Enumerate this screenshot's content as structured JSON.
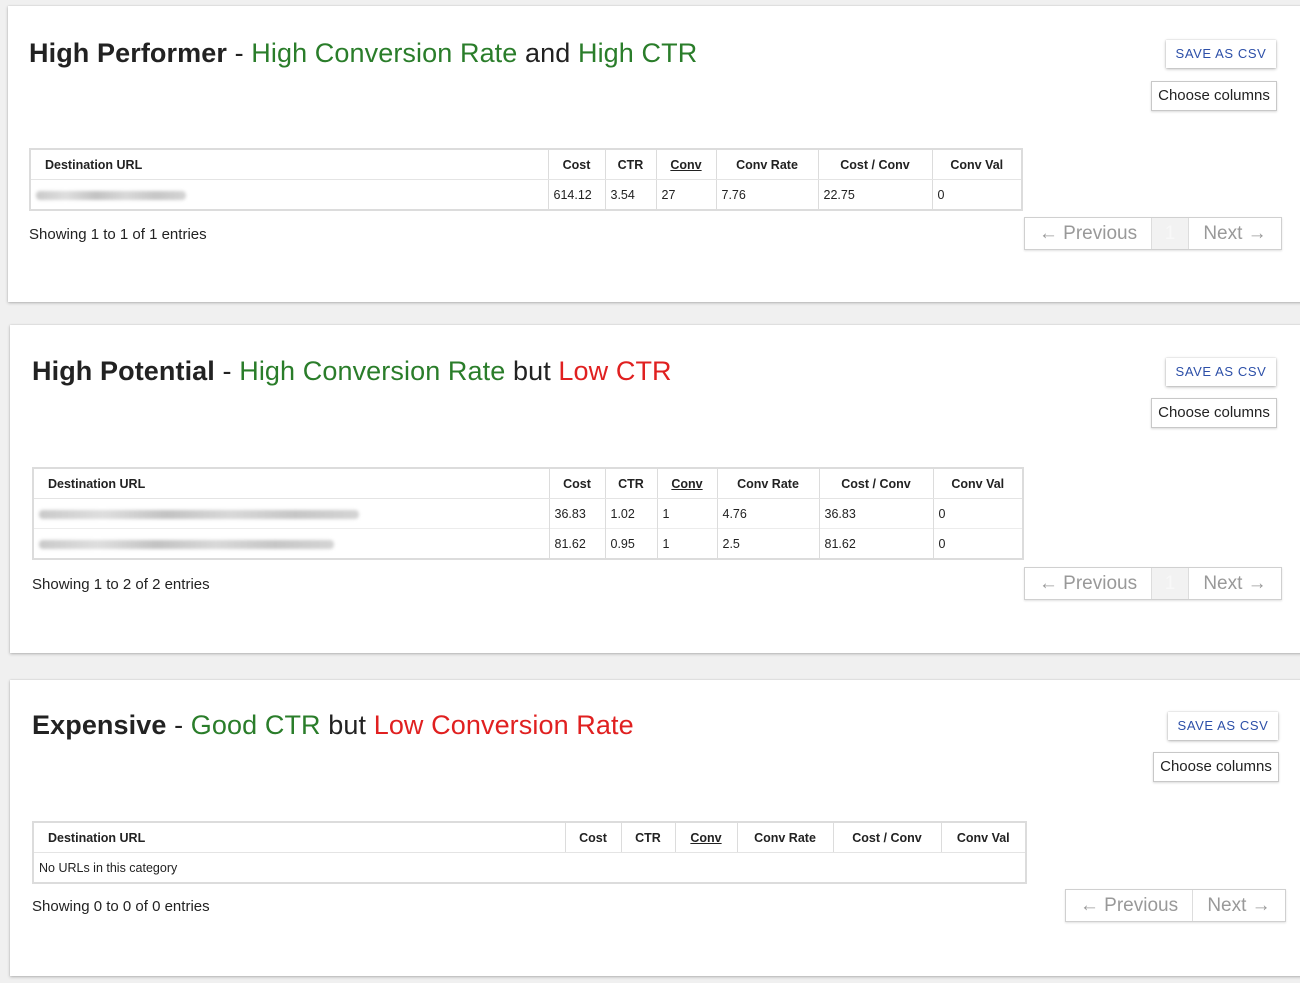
{
  "columns": [
    "Destination URL",
    "Cost",
    "CTR",
    "Conv",
    "Conv Rate",
    "Cost / Conv",
    "Conv Val"
  ],
  "buttons": {
    "save_csv": "SAVE AS CSV",
    "choose_columns": "Choose columns"
  },
  "pager": {
    "previous": "← Previous",
    "next": "Next →",
    "page": "1"
  },
  "sections": [
    {
      "title_main": "High Performer",
      "title_sep": "-",
      "title_part1": "High Conversion Rate",
      "title_conj": "and",
      "title_part2": "High CTR",
      "showing": "Showing 1 to 1 of 1 entries",
      "rows": [
        {
          "cost": "614.12",
          "ctr": "3.54",
          "conv": "27",
          "conv_rate": "7.76",
          "cost_conv": "22.75",
          "conv_val": "0"
        }
      ]
    },
    {
      "title_main": "High Potential",
      "title_sep": "-",
      "title_part1": "High Conversion Rate",
      "title_conj": "but",
      "title_part2": "Low CTR",
      "showing": "Showing 1 to 2 of 2 entries",
      "rows": [
        {
          "cost": "36.83",
          "ctr": "1.02",
          "conv": "1",
          "conv_rate": "4.76",
          "cost_conv": "36.83",
          "conv_val": "0"
        },
        {
          "cost": "81.62",
          "ctr": "0.95",
          "conv": "1",
          "conv_rate": "2.5",
          "cost_conv": "81.62",
          "conv_val": "0"
        }
      ]
    },
    {
      "title_main": "Expensive",
      "title_sep": "-",
      "title_part1": "Good CTR",
      "title_conj": "but",
      "title_part2": "Low Conversion Rate",
      "showing": "Showing 0 to 0 of 0 entries",
      "empty_message": "No URLs in this category",
      "rows": []
    }
  ],
  "colors": {
    "good": "#2a7d2a",
    "bad": "#e02020",
    "link": "#2c4fa8"
  }
}
